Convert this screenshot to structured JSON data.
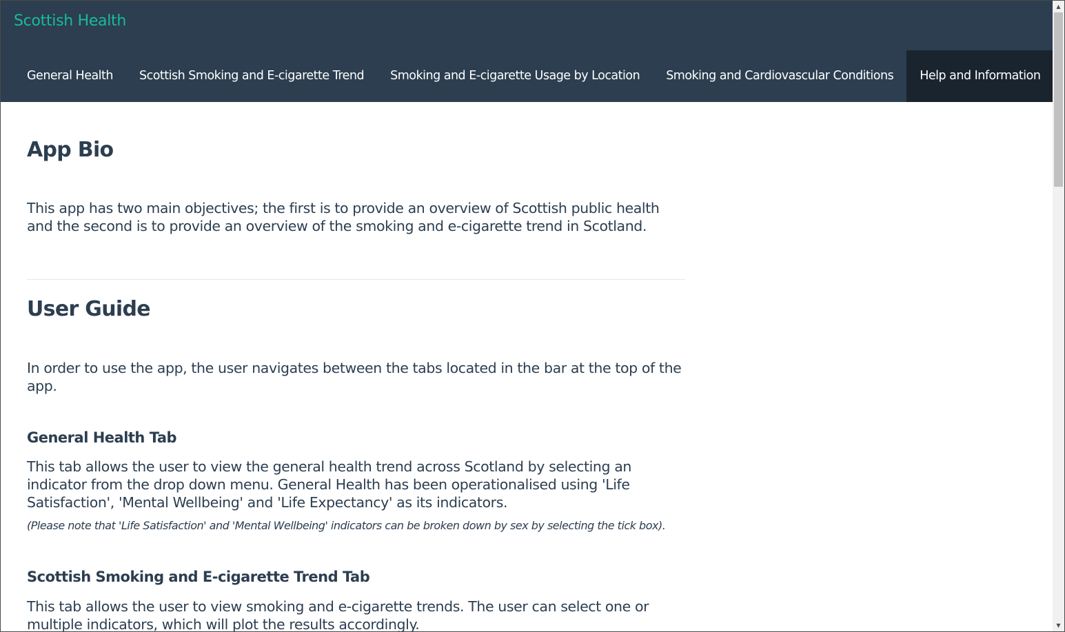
{
  "brand": "Scottish Health",
  "nav": {
    "tabs": [
      {
        "label": "General Health"
      },
      {
        "label": "Scottish Smoking and E-cigarette Trend"
      },
      {
        "label": "Smoking and E-cigarette Usage by Location"
      },
      {
        "label": "Smoking and Cardiovascular Conditions"
      },
      {
        "label": "Help and Information",
        "active": true
      }
    ]
  },
  "content": {
    "app_bio": {
      "heading": "App Bio",
      "text": "This app has two main objectives; the first is to provide an overview of Scottish public health and the second is to provide an overview of the smoking and e-cigarette trend in Scotland."
    },
    "user_guide": {
      "heading": "User Guide",
      "intro": "In order to use the app, the user navigates between the tabs located in the bar at the top of the app.",
      "sections": [
        {
          "heading": "General Health Tab",
          "text": "This tab allows the user to view the general health trend across Scotland by selecting an indicator from the drop down menu. General Health has been operationalised using 'Life Satisfaction', 'Mental Wellbeing' and 'Life Expectancy' as its indicators.",
          "note": "(Please note that 'Life Satisfaction' and 'Mental Wellbeing' indicators can be broken down by sex by selecting the tick box)."
        },
        {
          "heading": "Scottish Smoking and E-cigarette Trend Tab",
          "text": "This tab allows the user to view smoking and e-cigarette trends. The user can select one or multiple indicators, which will plot the results accordingly."
        }
      ]
    }
  },
  "colors": {
    "navbar_bg": "#2c3e50",
    "active_tab_bg": "#1a242f",
    "brand": "#18bc9c",
    "text": "#2c3e50"
  }
}
